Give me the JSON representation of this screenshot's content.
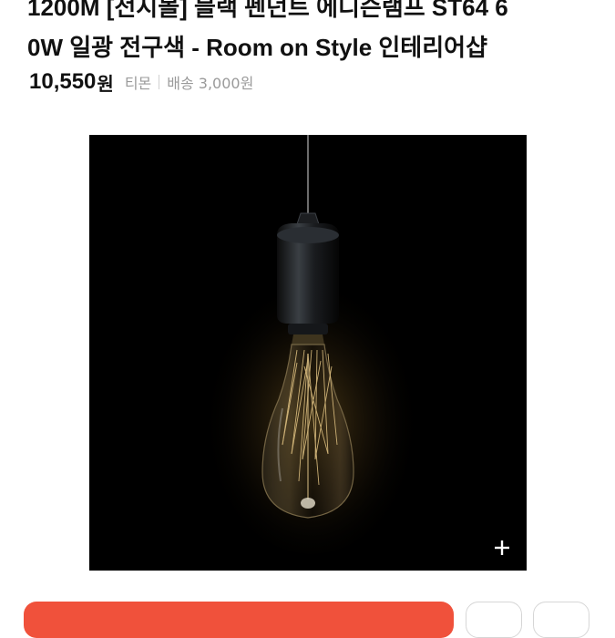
{
  "product": {
    "title_line1": "1200M [전시몰] 블랙 펜던트 에디슨램프 ST64 6",
    "title_line2": "0W 일광 전구색 - Room on Style 인테리어샵",
    "price": "10,550",
    "currency": "원",
    "seller": "티몬",
    "shipping": "배송 3,000원"
  },
  "image": {
    "icon": "plus-icon"
  },
  "actions": {
    "buy_button_color": "#f0513b"
  }
}
